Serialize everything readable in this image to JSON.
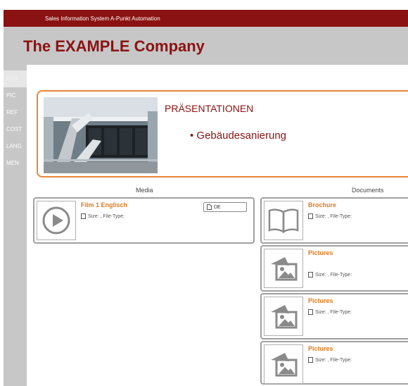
{
  "header": {
    "system_title": "Sales Information System A-Punkt Automation",
    "company": "The EXAMPLE Company"
  },
  "sidebar": {
    "items": [
      {
        "label": "PRÄ",
        "active": true
      },
      {
        "label": "PIC",
        "active": false
      },
      {
        "label": "REF",
        "active": false
      },
      {
        "label": "COST",
        "active": false
      },
      {
        "label": "LANG",
        "active": false
      },
      {
        "label": "MEN",
        "active": false
      }
    ]
  },
  "hero": {
    "title": "PRÄSENTATIONEN",
    "bullet": "Gebäudesanierung"
  },
  "media": {
    "heading": "Media",
    "items": [
      {
        "title": "Film 1 Englisch",
        "meta": "Size: , File-Type:",
        "language": "DE",
        "icon": "play-icon"
      }
    ]
  },
  "documents": {
    "heading": "Documents",
    "items": [
      {
        "title": "Brochure",
        "meta": "Size: , File-Type:",
        "icon": "book-icon"
      },
      {
        "title": "Pictures",
        "meta": "Size: , File-Type:",
        "icon": "picture-icon"
      },
      {
        "title": "Pictures",
        "meta": "Size: , File-Type:",
        "icon": "picture-icon"
      },
      {
        "title": "Pictures",
        "meta": "Size: , File-Type:",
        "icon": "picture-icon"
      }
    ]
  },
  "colors": {
    "brand": "#8b1212",
    "accent": "#e07a1e",
    "hero_border": "#e8863a",
    "chrome_gray": "#c7c7c7"
  }
}
